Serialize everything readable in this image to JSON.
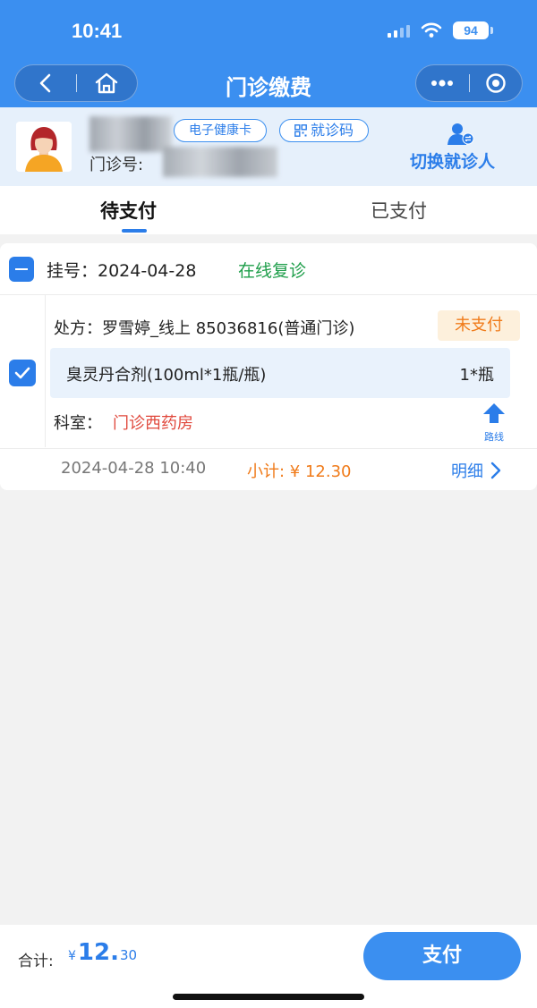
{
  "status_bar": {
    "time": "10:41",
    "battery": "94"
  },
  "nav": {
    "title": "门诊缴费"
  },
  "patient": {
    "health_card_tag": "电子健康卡",
    "visit_code_tag": "就诊码",
    "clinic_number_label": "门诊号:",
    "switch_label": "切换就诊人"
  },
  "tabs": [
    {
      "label": "待支付",
      "active": true
    },
    {
      "label": "已支付",
      "active": false
    }
  ],
  "order": {
    "registration_label": "挂号：2024-04-28",
    "registration_type": "在线复诊",
    "prescription": "处方：罗雪婷_线上 85036816(普通门诊)",
    "status": "未支付",
    "drug_name": "臭灵丹合剂(100ml*1瓶/瓶)",
    "drug_qty": "1*瓶",
    "dept_label": "科室：",
    "dept_value": "门诊西药房",
    "route_label": "路线",
    "time": "2024-04-28 10:40",
    "subtotal": "小计: ¥ 12.30",
    "detail_label": "明细"
  },
  "footer": {
    "total_label": "合计:",
    "total_currency": "¥",
    "total_int": "12.",
    "total_dec": "30",
    "pay_label": "支付"
  },
  "colors": {
    "brand_blue": "#3b8ff0",
    "green": "#1e9e4a",
    "orange": "#f07b1a",
    "red": "#e0483c"
  }
}
